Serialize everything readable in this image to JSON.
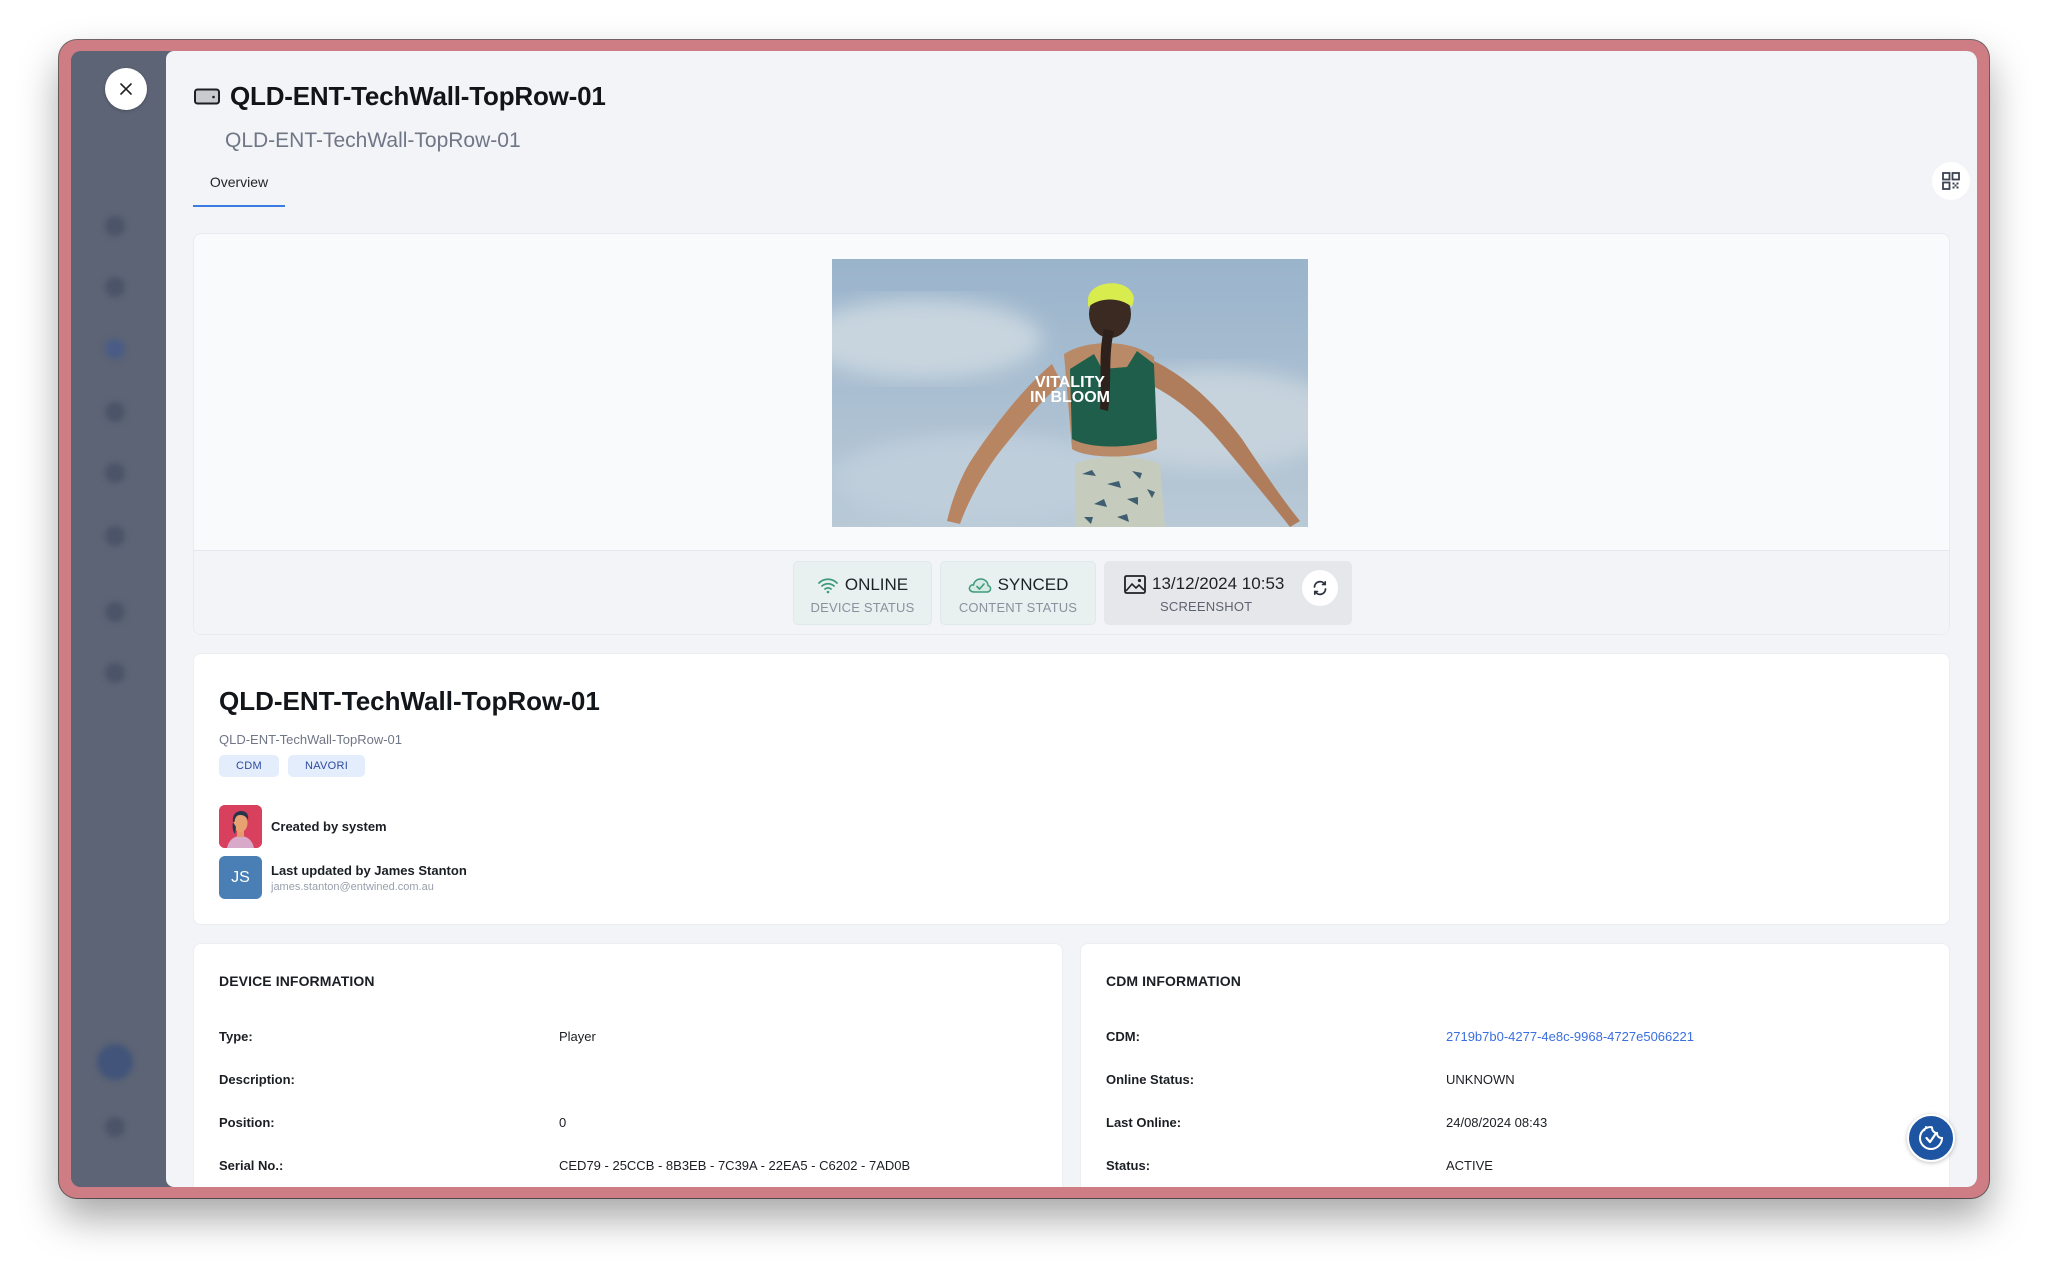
{
  "header": {
    "title": "QLD-ENT-TechWall-TopRow-01",
    "subtitle": "QLD-ENT-TechWall-TopRow-01",
    "close_label": "×"
  },
  "tabs": [
    {
      "label": "Overview",
      "active": true
    }
  ],
  "toolbar": {
    "qr_icon": "qr-code-icon",
    "more_icon": "more-horizontal-icon"
  },
  "preview": {
    "image_text_line1": "VITALITY",
    "image_text_line2": "IN BLOOM",
    "statuses": [
      {
        "icon": "wifi-icon",
        "value": "ONLINE",
        "label": "DEVICE STATUS",
        "color": "#3f9a7c"
      },
      {
        "icon": "cloud-check-icon",
        "value": "SYNCED",
        "label": "CONTENT STATUS",
        "color": "#3f9a7c"
      },
      {
        "icon": "image-icon",
        "value": "13/12/2024 10:53",
        "label": "SCREENSHOT"
      }
    ]
  },
  "info": {
    "name": "QLD-ENT-TechWall-TopRow-01",
    "sub": "QLD-ENT-TechWall-TopRow-01",
    "tags": [
      "CDM",
      "NAVORI"
    ],
    "created": {
      "text": "Created by system"
    },
    "updated": {
      "initials": "JS",
      "text": "Last updated by James Stanton",
      "email": "james.stanton@entwined.com.au"
    }
  },
  "device_info": {
    "title": "DEVICE INFORMATION",
    "rows": [
      {
        "key": "Type:",
        "value": "Player"
      },
      {
        "key": "Description:",
        "value": ""
      },
      {
        "key": "Position:",
        "value": "0"
      },
      {
        "key": "Serial No.:",
        "value": "CED79 - 25CCB - 8B3EB - 7C39A - 22EA5 - C6202 - 7AD0B"
      }
    ]
  },
  "cdm_info": {
    "title": "CDM INFORMATION",
    "rows": [
      {
        "key": "CDM:",
        "value": "2719b7b0-4277-4e8c-9968-4727e5066221",
        "link": true
      },
      {
        "key": "Online Status:",
        "value": "UNKNOWN"
      },
      {
        "key": "Last Online:",
        "value": "24/08/2024 08:43"
      },
      {
        "key": "Status:",
        "value": "ACTIVE"
      }
    ]
  },
  "colors": {
    "frame": "#cd7d83",
    "accent": "#3b7be4",
    "status_green": "#3f9a7c",
    "link": "#3a6fe0",
    "cookie_button": "#1e55a3"
  }
}
